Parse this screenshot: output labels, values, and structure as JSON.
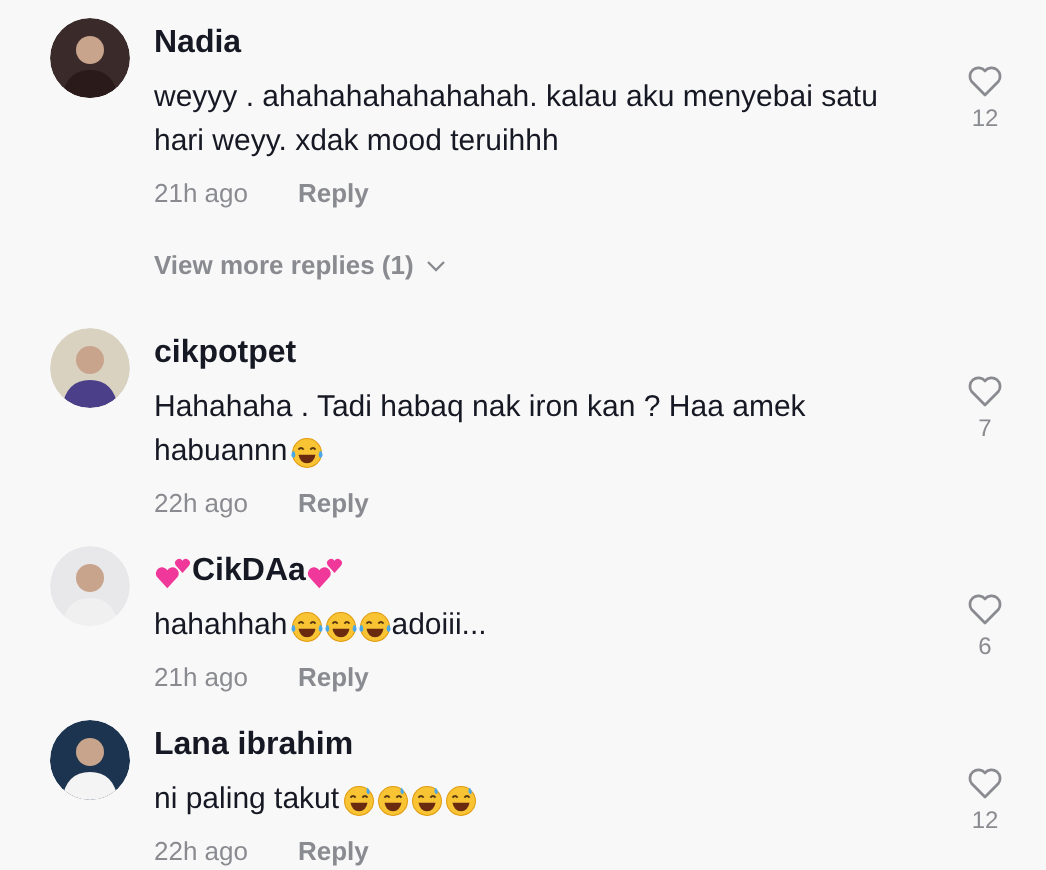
{
  "comments": [
    {
      "name": [
        {
          "kind": "text",
          "text": "Nadia"
        }
      ],
      "body": [
        {
          "kind": "text",
          "text": "weyyy . ahahahahahahahah. kalau aku menyebai satu hari weyy. xdak mood teruihhh"
        }
      ],
      "time": "21h ago",
      "reply": "Reply",
      "likes": "12",
      "more_replies": "View more replies (1)"
    },
    {
      "name": [
        {
          "kind": "text",
          "text": "cikpotpet"
        }
      ],
      "body": [
        {
          "kind": "text",
          "text": "Hahahaha . Tadi habaq nak iron kan ? Haa amek "
        },
        {
          "kind": "text",
          "text": "habuannn"
        },
        {
          "kind": "joy"
        }
      ],
      "time": "22h ago",
      "reply": "Reply",
      "likes": "7"
    },
    {
      "name": [
        {
          "kind": "hearts"
        },
        {
          "kind": "text",
          "text": "CikDAa"
        },
        {
          "kind": "hearts"
        }
      ],
      "body": [
        {
          "kind": "text",
          "text": "hahahhah"
        },
        {
          "kind": "joy"
        },
        {
          "kind": "joy"
        },
        {
          "kind": "joy"
        },
        {
          "kind": "text",
          "text": "adoiii..."
        }
      ],
      "time": "21h ago",
      "reply": "Reply",
      "likes": "6"
    },
    {
      "name": [
        {
          "kind": "text",
          "text": "Lana ibrahim"
        }
      ],
      "body": [
        {
          "kind": "text",
          "text": "ni paling takut"
        },
        {
          "kind": "sweat"
        },
        {
          "kind": "sweat"
        },
        {
          "kind": "sweat"
        },
        {
          "kind": "sweat"
        }
      ],
      "time": "22h ago",
      "reply": "Reply",
      "likes": "12"
    }
  ]
}
